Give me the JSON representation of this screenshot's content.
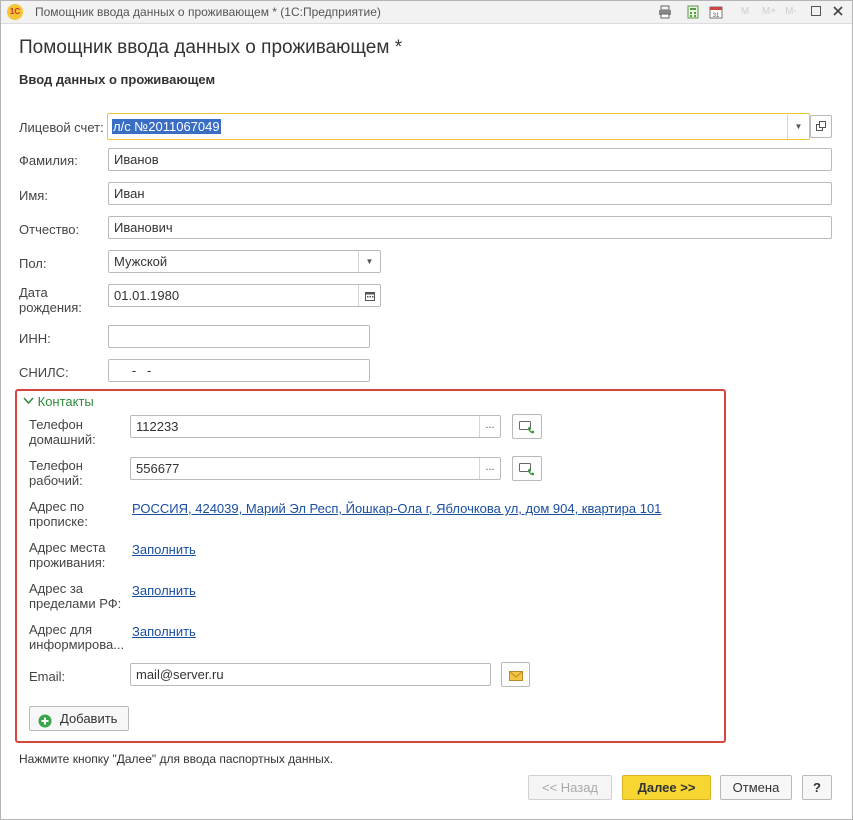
{
  "window": {
    "app_logo": "1С",
    "title": "Помощник ввода данных о проживающем * (1С:Предприятие)",
    "toolbar_icons": [
      "print-icon",
      "calculator-icon",
      "calendar-icon",
      "memory-m-icon",
      "memory-mplus-icon",
      "memory-mminus-icon",
      "restore-icon",
      "close-icon"
    ],
    "toolbar_labels": [
      "M",
      "M+",
      "M-"
    ]
  },
  "form": {
    "title": "Помощник ввода данных о проживающем *",
    "subtitle": "Ввод данных о проживающем"
  },
  "fields": {
    "account": {
      "label": "Лицевой счет:",
      "value": "л/с №2011067049"
    },
    "last_name": {
      "label": "Фамилия:",
      "value": "Иванов"
    },
    "first_name": {
      "label": "Имя:",
      "value": "Иван"
    },
    "middle_name": {
      "label": "Отчество:",
      "value": "Иванович"
    },
    "gender": {
      "label": "Пол:",
      "value": "Мужской"
    },
    "birth_date": {
      "label_line1": "Дата",
      "label_line2": "рождения:",
      "value": "01.01.1980"
    },
    "inn": {
      "label": "ИНН:",
      "value": ""
    },
    "snils": {
      "label": "СНИЛС:",
      "value": "   -   -"
    }
  },
  "contacts": {
    "header": "Контакты",
    "home_phone": {
      "label_line1": "Телефон",
      "label_line2": "домашний:",
      "value": "112233"
    },
    "work_phone": {
      "label_line1": "Телефон",
      "label_line2": "рабочий:",
      "value": "556677"
    },
    "reg_address": {
      "label_line1": "Адрес по",
      "label_line2": "прописке:",
      "value": "РОССИЯ, 424039, Марий Эл Респ, Йошкар-Ола г, Яблочкова ул, дом 904, квартира 101"
    },
    "live_address": {
      "label_line1": "Адрес места",
      "label_line2": "проживания:",
      "value": "Заполнить"
    },
    "abroad_address": {
      "label_line1": "Адрес за",
      "label_line2": "пределами РФ:",
      "value": "Заполнить"
    },
    "info_address": {
      "label_line1": "Адрес для",
      "label_line2": "информирова...",
      "value": "Заполнить"
    },
    "email": {
      "label": "Email:",
      "value": "mail@server.ru"
    },
    "add_button": "Добавить"
  },
  "footer": {
    "hint": "Нажмите кнопку \"Далее\" для ввода паспортных данных.",
    "back": "<< Назад",
    "next": "Далее >>",
    "cancel": "Отмена",
    "help": "?"
  },
  "colors": {
    "accent_yellow": "#f8d631",
    "contacts_border": "#d8453c",
    "link": "#1a4ea1",
    "group_header": "#2f8a3c",
    "selection": "#3a6ec4"
  }
}
